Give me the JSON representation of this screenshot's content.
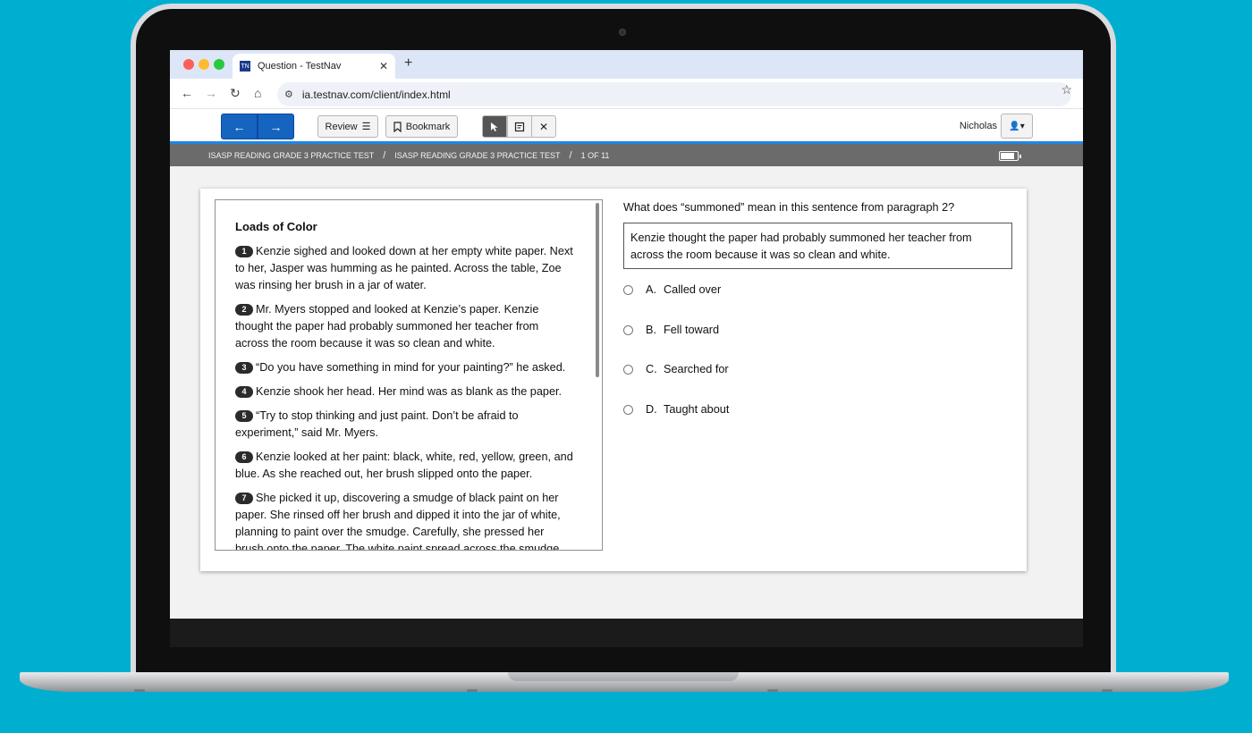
{
  "browser": {
    "tab_title": "Question - TestNav",
    "favicon_text": "TN",
    "url": "ia.testnav.com/client/index.html"
  },
  "testnav": {
    "review_label": "Review",
    "bookmark_label": "Bookmark",
    "user_name": "Nicholas",
    "breadcrumb": [
      "ISASP READING GRADE 3 PRACTICE TEST",
      "ISASP READING GRADE 3 PRACTICE TEST",
      "1 OF 11"
    ],
    "battery_level": 0.85
  },
  "passage": {
    "title": "Loads of Color",
    "paragraphs": [
      {
        "num": "1",
        "text": "Kenzie sighed and looked down at her empty white paper. Next to her, Jasper was humming as he painted. Across the table, Zoe was rinsing her brush in a jar of water."
      },
      {
        "num": "2",
        "text": "Mr. Myers stopped and looked at Kenzie’s paper. Kenzie thought the paper had probably summoned her teacher from across the room because it was so clean and white."
      },
      {
        "num": "3",
        "text": "“Do you have something in mind for your painting?” he asked."
      },
      {
        "num": "4",
        "text": "Kenzie shook her head. Her mind was as blank as the paper."
      },
      {
        "num": "5",
        "text": "“Try to stop thinking and just paint. Don’t be afraid to experiment,” said Mr. Myers."
      },
      {
        "num": "6",
        "text": "Kenzie looked at her paint: black, white, red, yellow, green, and blue. As she reached out, her brush slipped onto the paper."
      },
      {
        "num": "7",
        "text": "She picked it up, discovering a smudge of black paint on her paper. She rinsed off her brush and dipped it into the jar of white, planning to paint over the smudge. Carefully, she pressed her brush onto the paper. The white paint spread across the smudge."
      }
    ]
  },
  "question": {
    "prompt": "What does “summoned” mean in this sentence from paragraph 2?",
    "quote": "Kenzie thought the paper had probably summoned her teacher from across the room because it was so clean and white.",
    "options": [
      {
        "letter": "A.",
        "text": "Called over"
      },
      {
        "letter": "B.",
        "text": "Fell toward"
      },
      {
        "letter": "C.",
        "text": "Searched for"
      },
      {
        "letter": "D.",
        "text": "Taught about"
      }
    ]
  }
}
